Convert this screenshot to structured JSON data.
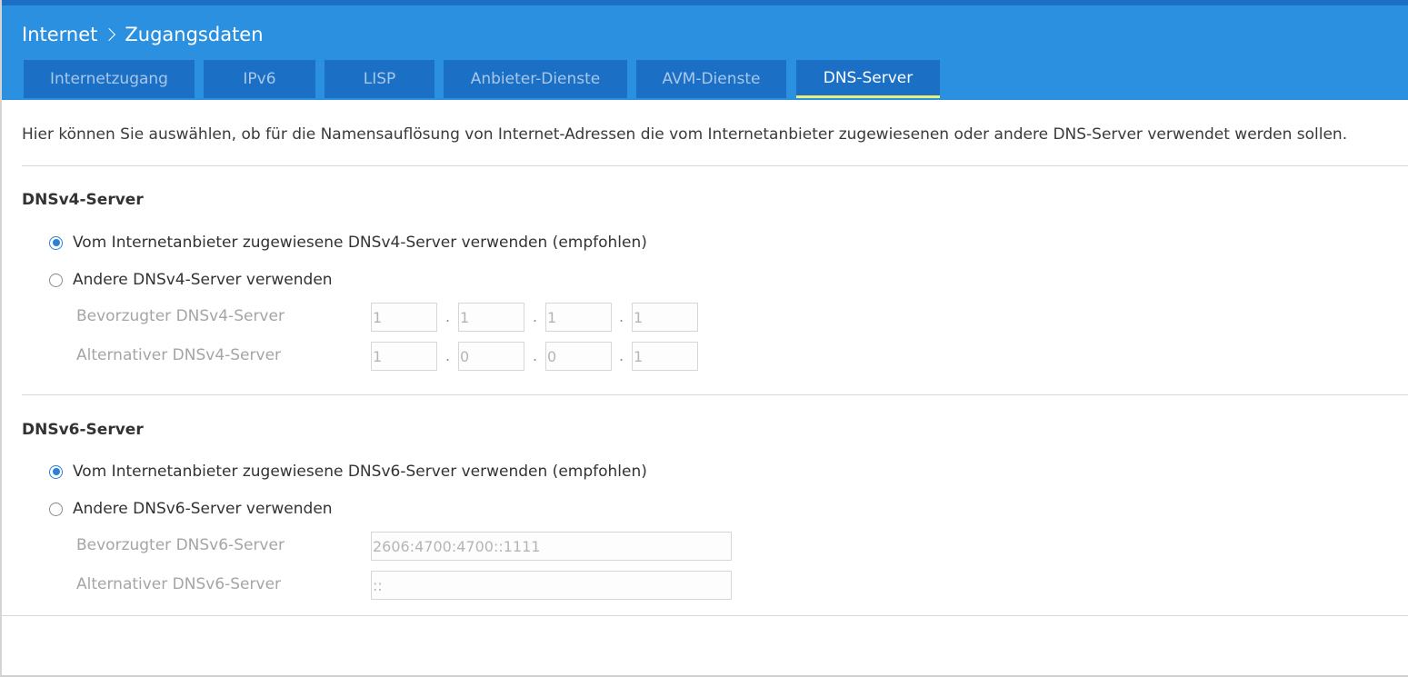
{
  "breadcrumb": {
    "section": "Internet",
    "page": "Zugangsdaten"
  },
  "tabs": [
    {
      "label": "Internetzugang",
      "active": false
    },
    {
      "label": "IPv6",
      "active": false
    },
    {
      "label": "LISP",
      "active": false
    },
    {
      "label": "Anbieter-Dienste",
      "active": false
    },
    {
      "label": "AVM-Dienste",
      "active": false
    },
    {
      "label": "DNS-Server",
      "active": true
    }
  ],
  "intro": "Hier können Sie auswählen, ob für die Namensauflösung von Internet-Adressen die vom Internetanbieter zugewiesenen oder andere DNS-Server verwendet werden sollen.",
  "dnsv4": {
    "title": "DNSv4-Server",
    "option_provider": "Vom Internetanbieter zugewiesene DNSv4-Server verwenden (empfohlen)",
    "option_other": "Andere DNSv4-Server verwenden",
    "selected": "provider",
    "preferred_label": "Bevorzugter DNSv4-Server",
    "alternative_label": "Alternativer DNSv4-Server",
    "preferred_octets": [
      "1",
      "1",
      "1",
      "1"
    ],
    "alternative_octets": [
      "1",
      "0",
      "0",
      "1"
    ],
    "separator": "."
  },
  "dnsv6": {
    "title": "DNSv6-Server",
    "option_provider": "Vom Internetanbieter zugewiesene DNSv6-Server verwenden (empfohlen)",
    "option_other": "Andere DNSv6-Server verwenden",
    "selected": "provider",
    "preferred_label": "Bevorzugter DNSv6-Server",
    "alternative_label": "Alternativer DNSv6-Server",
    "preferred_value": "2606:4700:4700::1111",
    "alternative_value": "::"
  },
  "colors": {
    "header": "#2b90e0",
    "tab": "#1b6fc4",
    "active_tab_underline": "#e8f07a",
    "radio_checked": "#2b7fd6"
  }
}
